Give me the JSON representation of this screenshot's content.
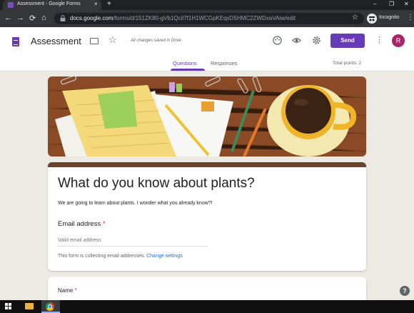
{
  "browser": {
    "tab_title": "Assessment - Google Forms",
    "tab_close": "×",
    "new_tab": "+",
    "url_host": "docs.google.com",
    "url_path": "/forms/d/151ZK80-gVb1Qcil7f1H1WCGpKEqxD5HMC2ZWDxaVAiw/edit",
    "profile_label": "Incognito",
    "window_controls": [
      "–",
      "❐",
      "✕"
    ],
    "nav": [
      "←",
      "→",
      "⟳",
      "⌂"
    ]
  },
  "header": {
    "title": "Assessment",
    "save_status": "All changes saved in Drive",
    "send_label": "Send",
    "avatar_letter": "R",
    "tabs": [
      {
        "label": "Questions",
        "active": true
      },
      {
        "label": "Responses",
        "active": false
      }
    ],
    "total_points": "Total points: 2",
    "accent_color": "#673ab7"
  },
  "form": {
    "title": "What do you know about plants?",
    "description": "We are going to learn about plants. I wonder what you already know?!",
    "email_label": "Email address",
    "required_mark": "*",
    "email_placeholder": "Valid email address",
    "collect_note": "This form is collecting email addresses.",
    "change_settings": "Change settings",
    "name_label": "Name"
  },
  "icons": [
    "forms-doc-icon",
    "folder-icon",
    "star-icon",
    "palette-icon",
    "eye-icon",
    "gear-icon",
    "kebab-icon",
    "help-icon"
  ]
}
